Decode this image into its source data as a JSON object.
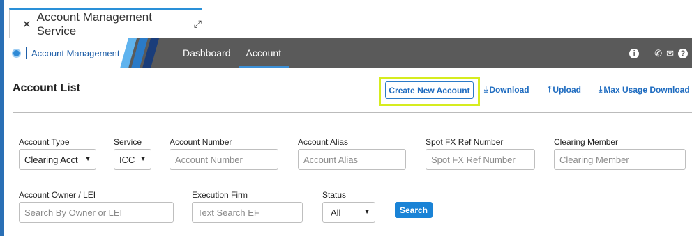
{
  "tab": {
    "title": "Account Management Service"
  },
  "brand": {
    "name": "Account Management"
  },
  "nav": {
    "items": [
      {
        "label": "Dashboard"
      },
      {
        "label": "Account"
      }
    ]
  },
  "page": {
    "title": "Account List",
    "actions": {
      "create": "Create New Account",
      "download": "Download",
      "upload": "Upload",
      "max_usage": "Max Usage Download"
    }
  },
  "filters": {
    "account_type": {
      "label": "Account Type",
      "value": "Clearing Acct"
    },
    "service": {
      "label": "Service",
      "value": "ICC"
    },
    "account_number": {
      "label": "Account Number",
      "placeholder": "Account Number"
    },
    "account_alias": {
      "label": "Account Alias",
      "placeholder": "Account Alias"
    },
    "spot_fx": {
      "label": "Spot FX Ref Number",
      "placeholder": "Spot FX Ref Number"
    },
    "clearing_member": {
      "label": "Clearing Member",
      "placeholder": "Clearing Member"
    },
    "owner_lei": {
      "label": "Account Owner / LEI",
      "placeholder": "Search By Owner or LEI"
    },
    "execution_firm": {
      "label": "Execution Firm",
      "placeholder": "Text Search EF"
    },
    "status": {
      "label": "Status",
      "value": "All"
    },
    "search_label": "Search"
  },
  "colors": {
    "accent": "#1f6cc0",
    "navbar": "#5a5a5a",
    "highlight": "#d6ec1f"
  }
}
